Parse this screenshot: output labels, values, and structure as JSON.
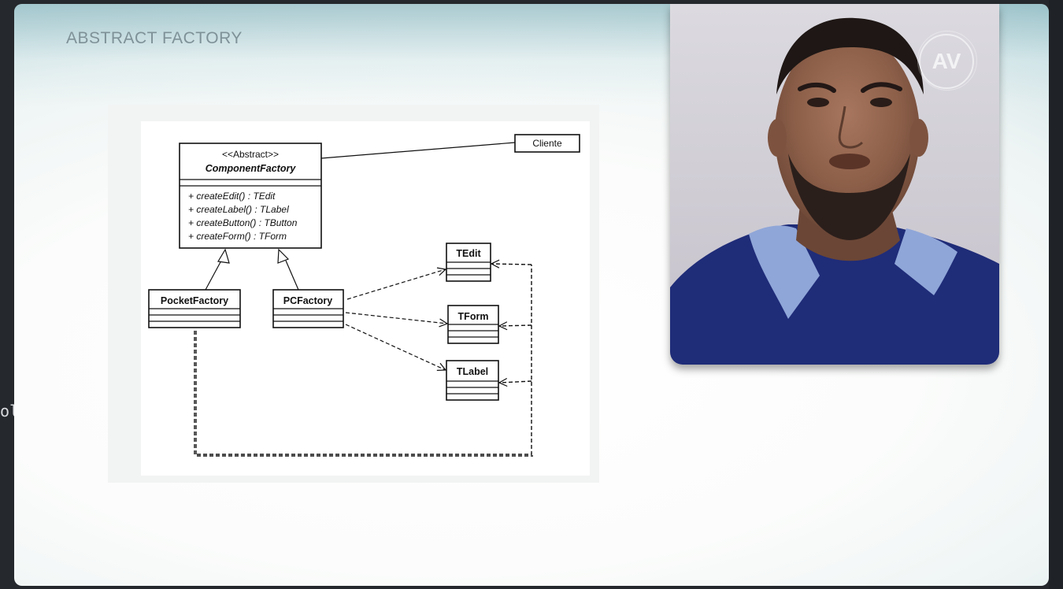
{
  "slide": {
    "title": "ABSTRACT FACTORY"
  },
  "edge_text": "ol",
  "uml": {
    "abstract_factory": {
      "stereotype": "<<Abstract>>",
      "name": "ComponentFactory",
      "methods": [
        "+ createEdit() : TEdit",
        "+ createLabel() : TLabel",
        "+ createButton() : TButton",
        "+ createForm() : TForm"
      ]
    },
    "client": "Cliente",
    "pocket_factory": "PocketFactory",
    "pc_factory": "PCFactory",
    "products": [
      "TEdit",
      "TForm",
      "TLabel"
    ]
  },
  "video": {
    "watermark": "AV"
  },
  "colors": {
    "title": "#7e9197",
    "shirt": "#1f2c78",
    "collar": "#8fa6d8"
  }
}
